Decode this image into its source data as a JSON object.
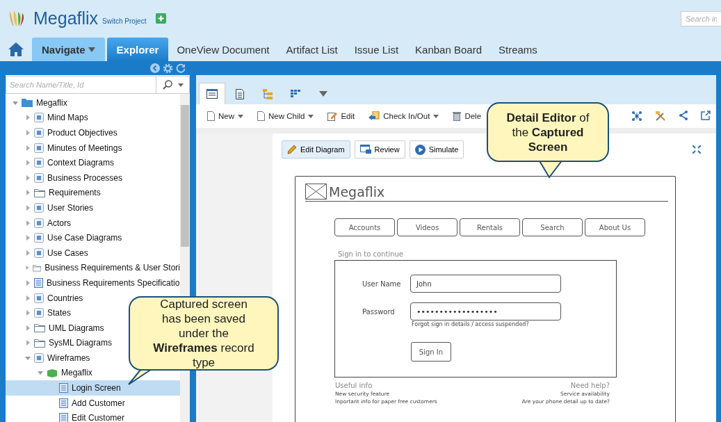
{
  "header": {
    "project": "Megaflix",
    "switch_link": "Switch Project",
    "search": {
      "placeholder": "Search in"
    }
  },
  "nav_tabs": [
    {
      "label": "Navigate",
      "kind": "menu",
      "selected": false
    },
    {
      "label": "Explorer",
      "kind": "tab",
      "selected": true
    },
    {
      "label": "OneView Document",
      "kind": "tab",
      "selected": false
    },
    {
      "label": "Artifact List",
      "kind": "tab",
      "selected": false
    },
    {
      "label": "Issue List",
      "kind": "tab",
      "selected": false
    },
    {
      "label": "Kanban Board",
      "kind": "tab",
      "selected": false
    },
    {
      "label": "Streams",
      "kind": "tab",
      "selected": false
    }
  ],
  "sidebar": {
    "search": {
      "placeholder": "Search Name/Title, Id"
    },
    "tree": [
      {
        "label": "Megaflix",
        "kind": "project",
        "expanded": true,
        "selected": false,
        "children": [
          {
            "label": "Mind Maps",
            "kind": "type",
            "expanded": false,
            "selected": false
          },
          {
            "label": "Product Objectives",
            "kind": "type",
            "expanded": false,
            "selected": false
          },
          {
            "label": "Minutes of Meetings",
            "kind": "type",
            "expanded": false,
            "selected": false
          },
          {
            "label": "Context Diagrams",
            "kind": "type",
            "expanded": false,
            "selected": false
          },
          {
            "label": "Business Processes",
            "kind": "type",
            "expanded": false,
            "selected": false
          },
          {
            "label": "Requirements",
            "kind": "folder",
            "expanded": false,
            "selected": false
          },
          {
            "label": "User Stories",
            "kind": "type",
            "expanded": false,
            "selected": false
          },
          {
            "label": "Actors",
            "kind": "type",
            "expanded": false,
            "selected": false
          },
          {
            "label": "Use Case Diagrams",
            "kind": "type",
            "expanded": false,
            "selected": false
          },
          {
            "label": "Use Cases",
            "kind": "type",
            "expanded": false,
            "selected": false
          },
          {
            "label": "Business Requirements & User Stori",
            "kind": "folder",
            "expanded": false,
            "selected": false
          },
          {
            "label": "Business Requirements Specificatio",
            "kind": "document",
            "expanded": false,
            "selected": false
          },
          {
            "label": "Countries",
            "kind": "type",
            "expanded": false,
            "selected": false
          },
          {
            "label": "States",
            "kind": "type",
            "expanded": false,
            "selected": false
          },
          {
            "label": "UML Diagrams",
            "kind": "folder",
            "expanded": false,
            "selected": false
          },
          {
            "label": "SysML Diagrams",
            "kind": "folder",
            "expanded": false,
            "selected": false
          },
          {
            "label": "Wireframes",
            "kind": "type",
            "expanded": true,
            "selected": false,
            "children": [
              {
                "label": "Megaflix",
                "kind": "package",
                "expanded": true,
                "selected": false,
                "children": [
                  {
                    "label": "Login Screen",
                    "kind": "document",
                    "selected": true
                  },
                  {
                    "label": "Add Customer",
                    "kind": "document",
                    "selected": false
                  },
                  {
                    "label": "Edit Customer",
                    "kind": "document",
                    "selected": false
                  }
                ]
              }
            ]
          }
        ]
      }
    ]
  },
  "view_tabs": [
    {
      "kind": "detail",
      "selected": true
    },
    {
      "kind": "document",
      "selected": false
    },
    {
      "kind": "tree",
      "selected": false
    },
    {
      "kind": "grid",
      "selected": false
    },
    {
      "kind": "more",
      "selected": false
    }
  ],
  "toolbar": [
    {
      "label": "New",
      "kind": "new",
      "has_menu": true
    },
    {
      "label": "New Child",
      "kind": "new",
      "has_menu": true
    },
    {
      "label": "Edit",
      "kind": "edit",
      "has_menu": false
    },
    {
      "label": "Check In/Out",
      "kind": "checkin",
      "has_menu": true
    },
    {
      "label": "Dele",
      "kind": "delete",
      "has_menu": false
    }
  ],
  "editor_buttons": [
    {
      "label": "Edit Diagram",
      "kind": "edit",
      "selected": true
    },
    {
      "label": "Review",
      "kind": "review",
      "selected": false
    },
    {
      "label": "Simulate",
      "kind": "play",
      "selected": false
    }
  ],
  "wireframe": {
    "logo": "Megaflix",
    "menu": [
      "Accounts",
      "Videos",
      "Rentals",
      "Search",
      "About Us"
    ],
    "heading": "Sign in to continue",
    "fields": [
      {
        "label": "User Name",
        "value": "John",
        "kind": "text"
      },
      {
        "label": "Password",
        "value": "••••••••••••••••••",
        "kind": "password"
      }
    ],
    "help_link": "Forgot sign in details / access suspended?",
    "button": "Sign In",
    "left_title": "Useful info",
    "left_links": [
      "New security feature",
      "Inportant info for paper free customers"
    ],
    "right_title": "Need help?",
    "right_links": [
      "Service availability",
      "Are your phone detail up to date?"
    ]
  },
  "callouts": [
    {
      "text": "**Detail Editor** of the **Captured Screen**"
    },
    {
      "text": "Captured screen has been saved under the **Wireframes** record type"
    }
  ]
}
